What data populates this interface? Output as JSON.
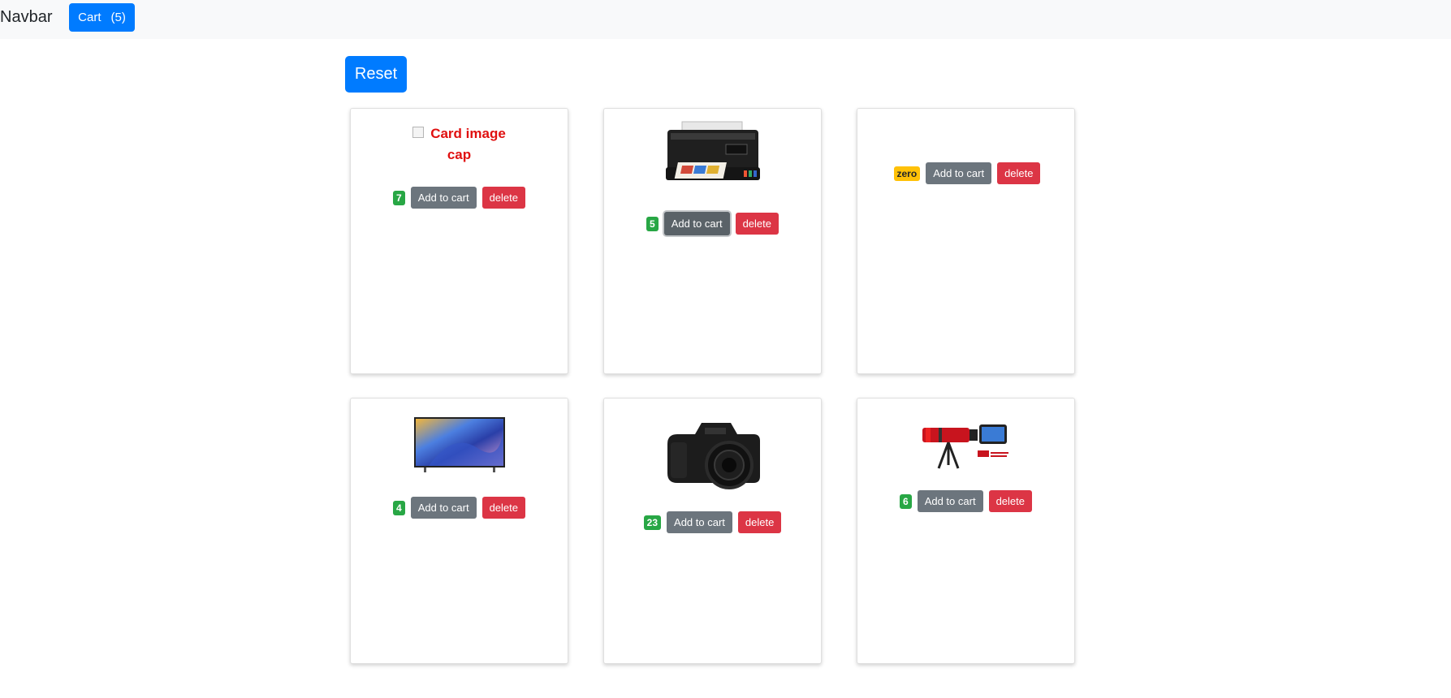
{
  "navbar": {
    "brand": "Navbar",
    "cart_label": "Cart",
    "cart_count": "(5)"
  },
  "reset_label": "Reset",
  "products": [
    {
      "count": "7",
      "image": "Card image cap",
      "image_alt_line1": "Card image",
      "image_alt_line2": "cap",
      "add_label": "Add to cart",
      "delete_label": "delete"
    },
    {
      "count": "5",
      "image": "printer",
      "add_label": "Add to cart",
      "delete_label": "delete"
    },
    {
      "count": "zero",
      "image": "none",
      "add_label": "Add to cart",
      "delete_label": "delete"
    },
    {
      "count": "4",
      "image": "television",
      "add_label": "Add to cart",
      "delete_label": "delete"
    },
    {
      "count": "23",
      "image": "camera",
      "add_label": "Add to cart",
      "delete_label": "delete"
    },
    {
      "count": "6",
      "image": "telephoto-lens",
      "add_label": "Add to cart",
      "delete_label": "delete"
    }
  ],
  "colors": {
    "primary": "#007bff",
    "secondary": "#6c757d",
    "danger": "#dc3545",
    "success": "#28a745",
    "warning": "#ffc107"
  }
}
